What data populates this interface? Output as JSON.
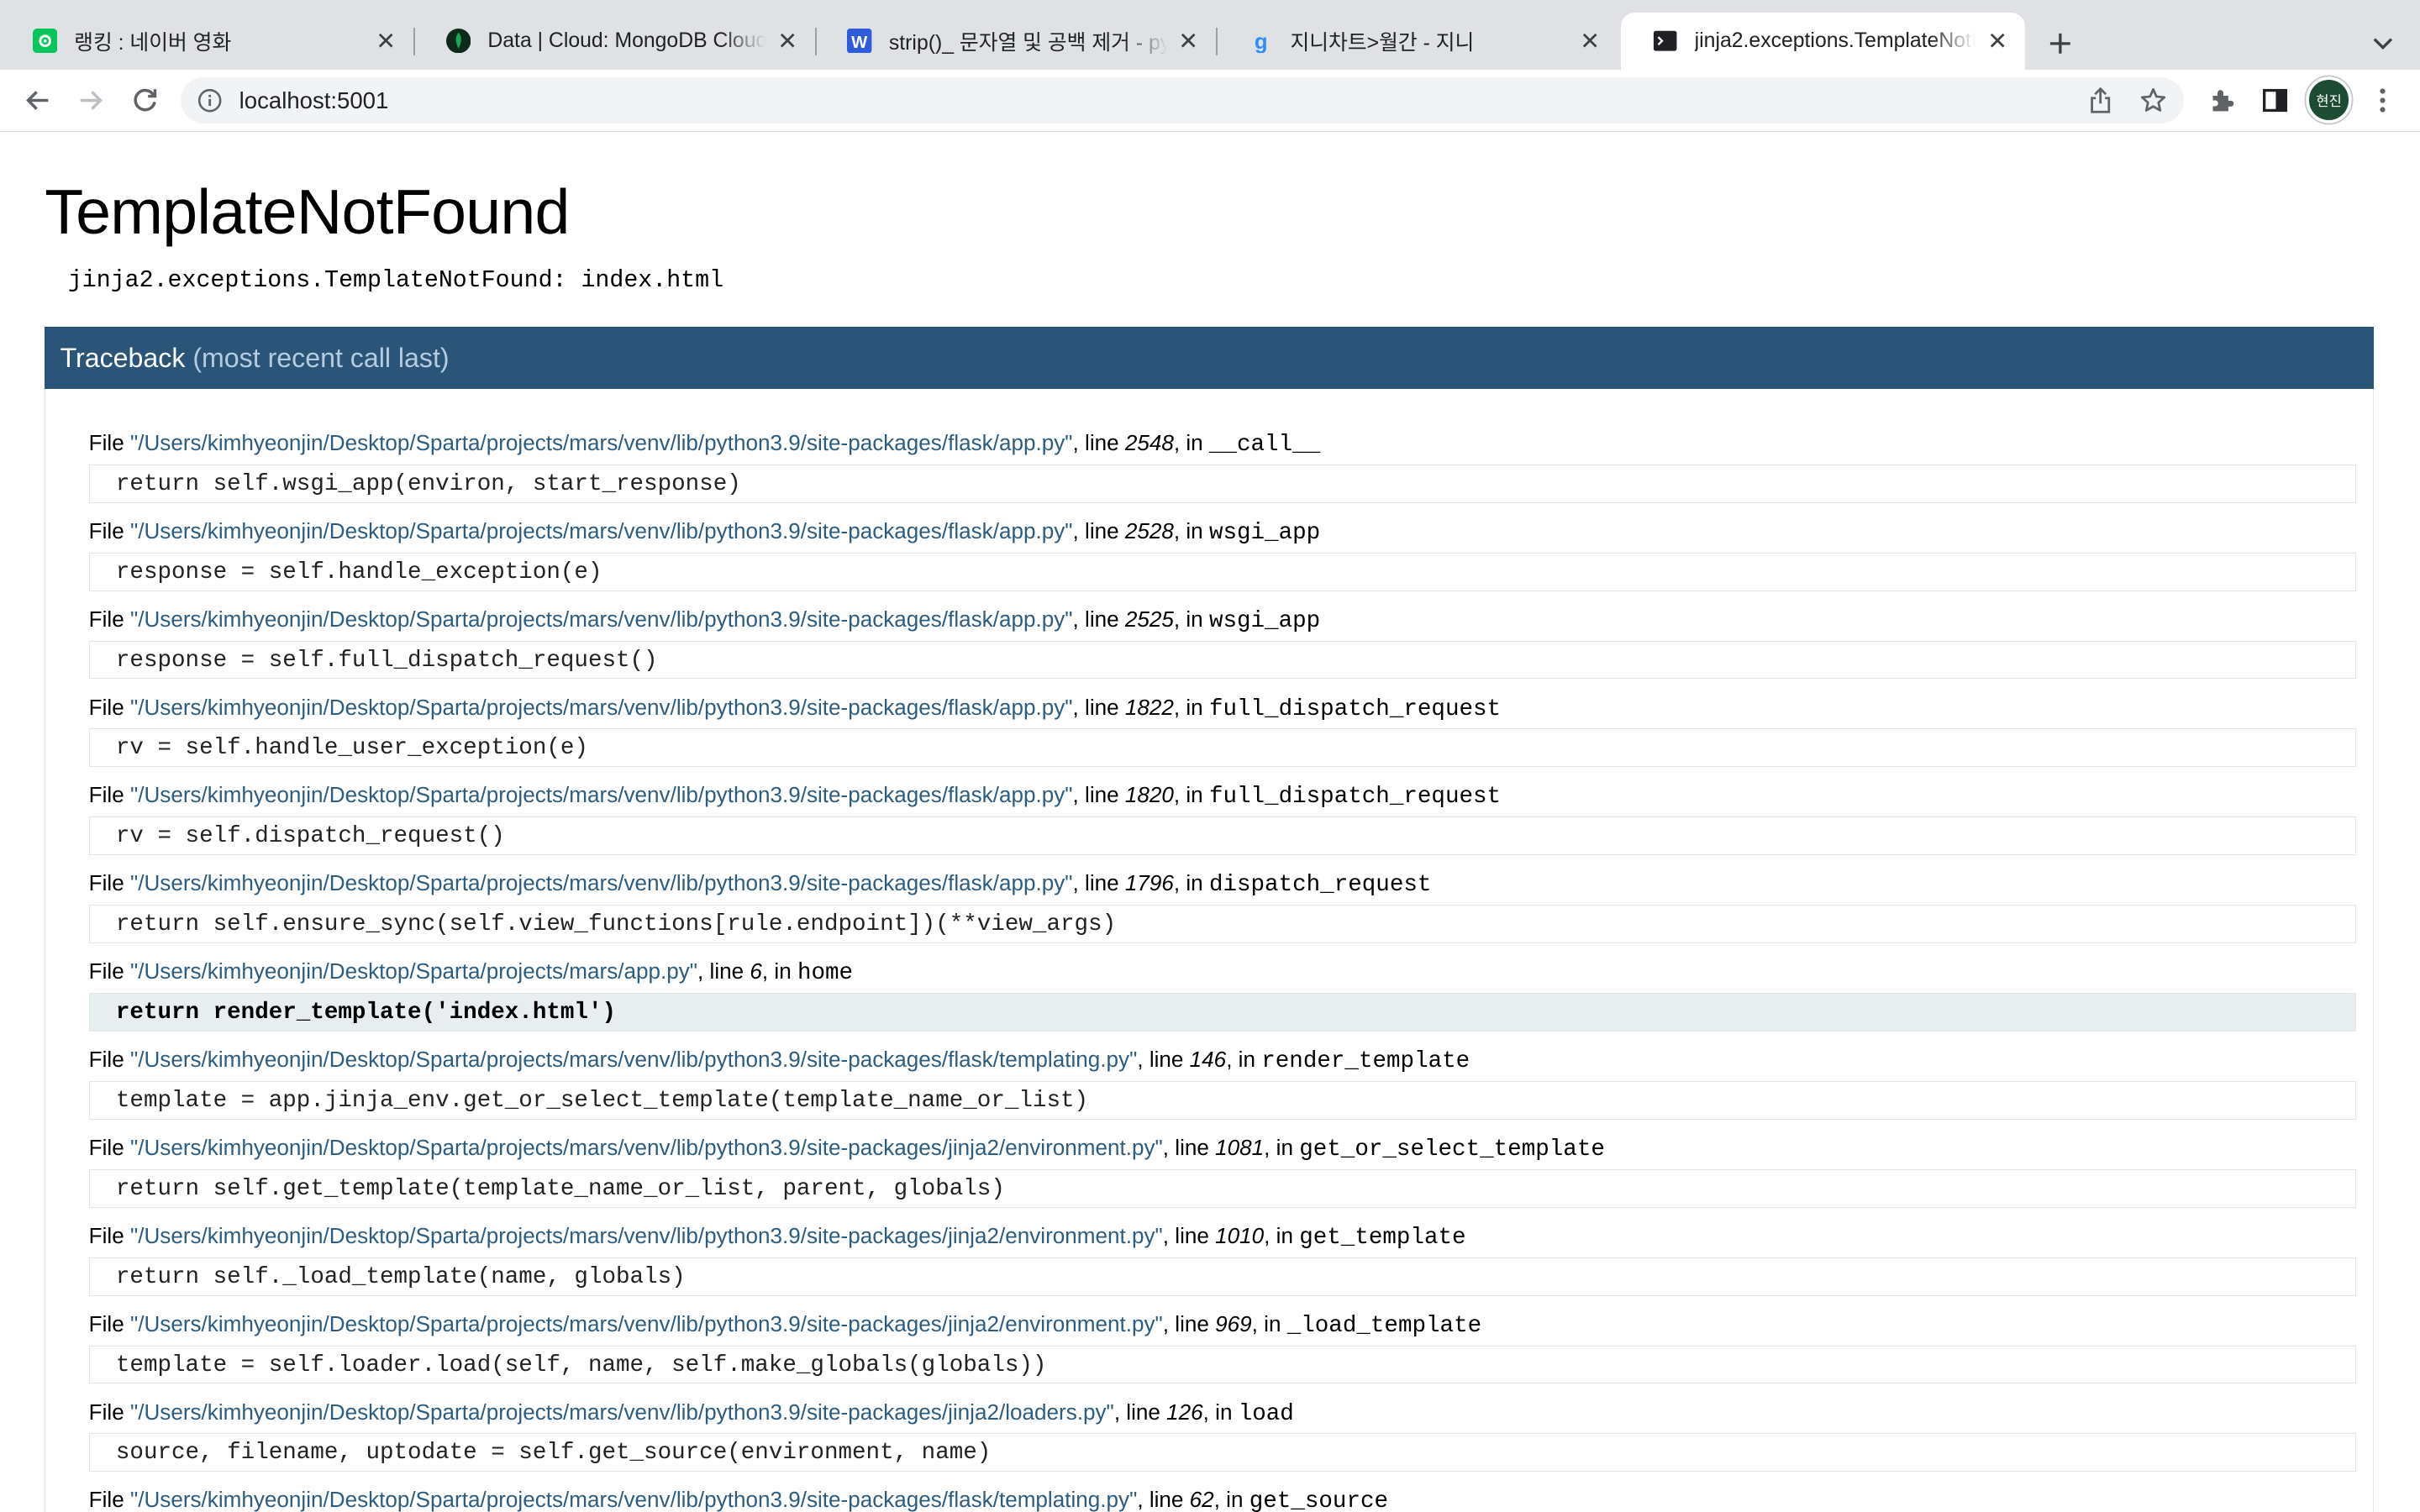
{
  "browser": {
    "tabs": [
      {
        "title": "랭킹 : 네이버 영화",
        "icon": "naver-movie-icon",
        "active": false
      },
      {
        "title": "Data | Cloud: MongoDB Cloud",
        "icon": "mongodb-leaf-icon",
        "active": false
      },
      {
        "title": "strip()_ 문자열 및 공백 제거 - python",
        "icon": "blog-w-icon",
        "active": false
      },
      {
        "title": "지니차트>월간 - 지니",
        "icon": "genie-g-icon",
        "active": false
      },
      {
        "title": "jinja2.exceptions.TemplateNotFound",
        "icon": "terminal-icon",
        "active": true
      }
    ],
    "url": "localhost:5001",
    "profile_initials": "현진"
  },
  "error": {
    "title": "TemplateNotFound",
    "message": "jinja2.exceptions.TemplateNotFound: index.html",
    "traceback_label": "Traceback",
    "traceback_sub": "(most recent call last)"
  },
  "frames": [
    {
      "file": "\"/Users/kimhyeonjin/Desktop/Sparta/projects/mars/venv/lib/python3.9/site-packages/flask/app.py\"",
      "line": "2548",
      "func": "__call__",
      "code": "return self.wsgi_app(environ, start_response)",
      "current": false
    },
    {
      "file": "\"/Users/kimhyeonjin/Desktop/Sparta/projects/mars/venv/lib/python3.9/site-packages/flask/app.py\"",
      "line": "2528",
      "func": "wsgi_app",
      "code": "response = self.handle_exception(e)",
      "current": false
    },
    {
      "file": "\"/Users/kimhyeonjin/Desktop/Sparta/projects/mars/venv/lib/python3.9/site-packages/flask/app.py\"",
      "line": "2525",
      "func": "wsgi_app",
      "code": "response = self.full_dispatch_request()",
      "current": false
    },
    {
      "file": "\"/Users/kimhyeonjin/Desktop/Sparta/projects/mars/venv/lib/python3.9/site-packages/flask/app.py\"",
      "line": "1822",
      "func": "full_dispatch_request",
      "code": "rv = self.handle_user_exception(e)",
      "current": false
    },
    {
      "file": "\"/Users/kimhyeonjin/Desktop/Sparta/projects/mars/venv/lib/python3.9/site-packages/flask/app.py\"",
      "line": "1820",
      "func": "full_dispatch_request",
      "code": "rv = self.dispatch_request()",
      "current": false
    },
    {
      "file": "\"/Users/kimhyeonjin/Desktop/Sparta/projects/mars/venv/lib/python3.9/site-packages/flask/app.py\"",
      "line": "1796",
      "func": "dispatch_request",
      "code": "return self.ensure_sync(self.view_functions[rule.endpoint])(**view_args)",
      "current": false
    },
    {
      "file": "\"/Users/kimhyeonjin/Desktop/Sparta/projects/mars/app.py\"",
      "line": "6",
      "func": "home",
      "code": "return render_template('index.html')",
      "current": true
    },
    {
      "file": "\"/Users/kimhyeonjin/Desktop/Sparta/projects/mars/venv/lib/python3.9/site-packages/flask/templating.py\"",
      "line": "146",
      "func": "render_template",
      "code": "template = app.jinja_env.get_or_select_template(template_name_or_list)",
      "current": false
    },
    {
      "file": "\"/Users/kimhyeonjin/Desktop/Sparta/projects/mars/venv/lib/python3.9/site-packages/jinja2/environment.py\"",
      "line": "1081",
      "func": "get_or_select_template",
      "code": "return self.get_template(template_name_or_list, parent, globals)",
      "current": false
    },
    {
      "file": "\"/Users/kimhyeonjin/Desktop/Sparta/projects/mars/venv/lib/python3.9/site-packages/jinja2/environment.py\"",
      "line": "1010",
      "func": "get_template",
      "code": "return self._load_template(name, globals)",
      "current": false
    },
    {
      "file": "\"/Users/kimhyeonjin/Desktop/Sparta/projects/mars/venv/lib/python3.9/site-packages/jinja2/environment.py\"",
      "line": "969",
      "func": "_load_template",
      "code": "template = self.loader.load(self, name, self.make_globals(globals))",
      "current": false
    },
    {
      "file": "\"/Users/kimhyeonjin/Desktop/Sparta/projects/mars/venv/lib/python3.9/site-packages/jinja2/loaders.py\"",
      "line": "126",
      "func": "load",
      "code": "source, filename, uptodate = self.get_source(environment, name)",
      "current": false
    },
    {
      "file": "\"/Users/kimhyeonjin/Desktop/Sparta/projects/mars/venv/lib/python3.9/site-packages/flask/templating.py\"",
      "line": "62",
      "func": "get_source",
      "code": "",
      "current": false
    }
  ],
  "labels": {
    "file": "File ",
    "line": ", line ",
    "in": ", in "
  },
  "colors": {
    "accent": "#2a5578",
    "link": "#2c5c82"
  }
}
